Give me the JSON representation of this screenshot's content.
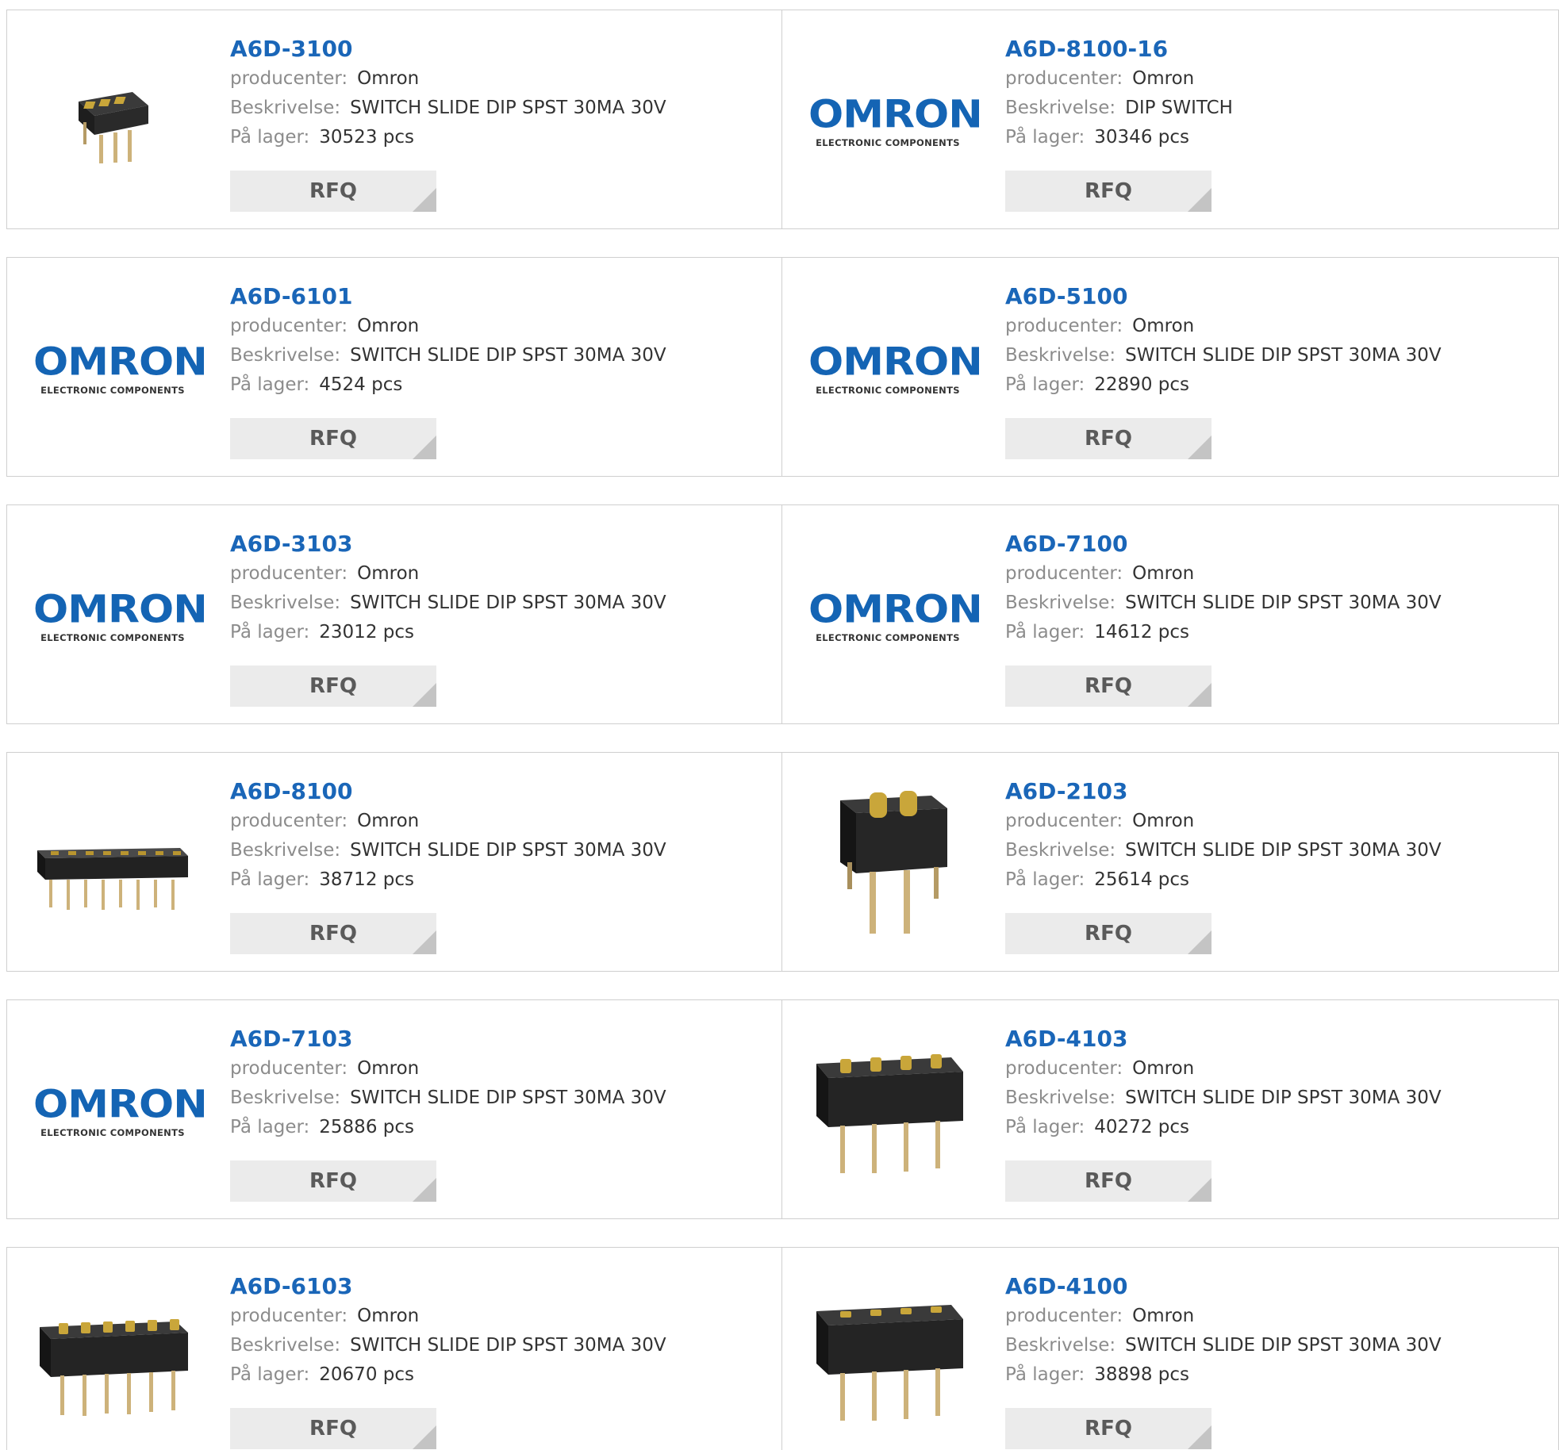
{
  "labels": {
    "manufacturer": "producenter:",
    "description": "Beskrivelse:",
    "stock": "På lager:",
    "rfq": "RFQ"
  },
  "logo": {
    "word": "OMRON",
    "sub": "ELECTRONIC COMPONENTS",
    "color": "#1464b4"
  },
  "products": [
    {
      "pn": "A6D-3100",
      "manufacturer": "Omron",
      "description": "SWITCH SLIDE DIP SPST 30MA 30V",
      "stock": "30523 pcs",
      "image": "dip-3-photo"
    },
    {
      "pn": "A6D-8100-16",
      "manufacturer": "Omron",
      "description": "DIP SWITCH",
      "stock": "30346 pcs",
      "image": "omron-logo"
    },
    {
      "pn": "A6D-6101",
      "manufacturer": "Omron",
      "description": "SWITCH SLIDE DIP SPST 30MA 30V",
      "stock": "4524 pcs",
      "image": "omron-logo"
    },
    {
      "pn": "A6D-5100",
      "manufacturer": "Omron",
      "description": "SWITCH SLIDE DIP SPST 30MA 30V",
      "stock": "22890 pcs",
      "image": "omron-logo"
    },
    {
      "pn": "A6D-3103",
      "manufacturer": "Omron",
      "description": "SWITCH SLIDE DIP SPST 30MA 30V",
      "stock": "23012 pcs",
      "image": "omron-logo"
    },
    {
      "pn": "A6D-7100",
      "manufacturer": "Omron",
      "description": "SWITCH SLIDE DIP SPST 30MA 30V",
      "stock": "14612 pcs",
      "image": "omron-logo"
    },
    {
      "pn": "A6D-8100",
      "manufacturer": "Omron",
      "description": "SWITCH SLIDE DIP SPST 30MA 30V",
      "stock": "38712 pcs",
      "image": "dip-8-photo"
    },
    {
      "pn": "A6D-2103",
      "manufacturer": "Omron",
      "description": "SWITCH SLIDE DIP SPST 30MA 30V",
      "stock": "25614 pcs",
      "image": "dip-2-photo"
    },
    {
      "pn": "A6D-7103",
      "manufacturer": "Omron",
      "description": "SWITCH SLIDE DIP SPST 30MA 30V",
      "stock": "25886 pcs",
      "image": "omron-logo"
    },
    {
      "pn": "A6D-4103",
      "manufacturer": "Omron",
      "description": "SWITCH SLIDE DIP SPST 30MA 30V",
      "stock": "40272 pcs",
      "image": "dip-4-photo"
    },
    {
      "pn": "A6D-6103",
      "manufacturer": "Omron",
      "description": "SWITCH SLIDE DIP SPST 30MA 30V",
      "stock": "20670 pcs",
      "image": "dip-6-photo"
    },
    {
      "pn": "A6D-4100",
      "manufacturer": "Omron",
      "description": "SWITCH SLIDE DIP SPST 30MA 30V",
      "stock": "38898 pcs",
      "image": "dip-4-photo"
    }
  ]
}
